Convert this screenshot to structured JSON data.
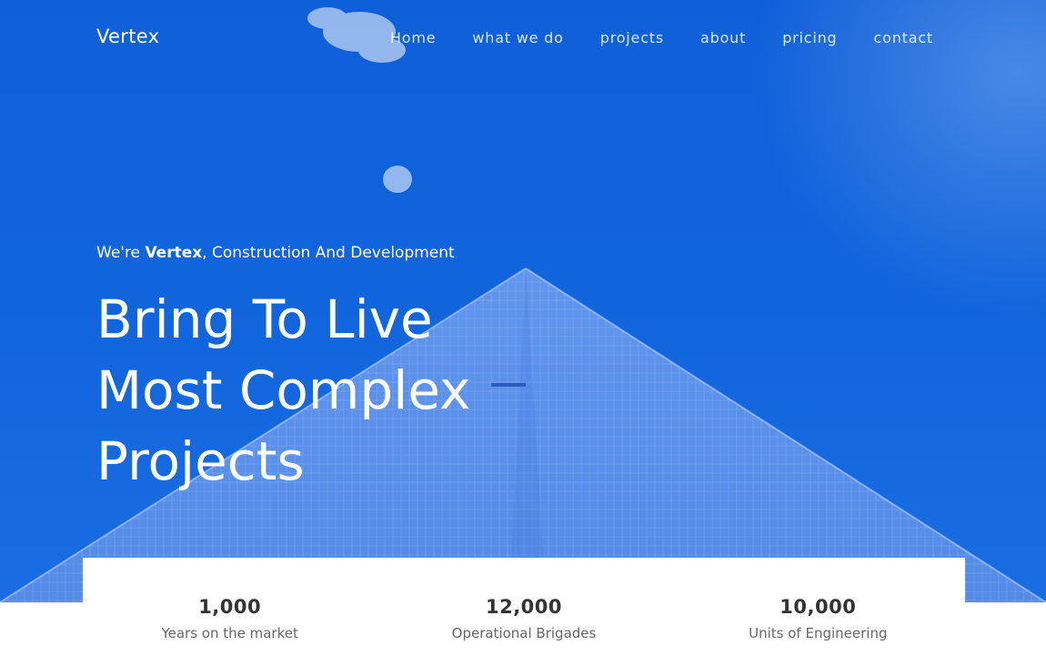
{
  "brand": "Vertex",
  "nav": {
    "items": [
      "Home",
      "what we do",
      "projects",
      "about",
      "pricing",
      "contact"
    ]
  },
  "hero": {
    "tagline_prefix": "We're ",
    "tagline_brand": "Vertex",
    "tagline_suffix": ", Construction And Development",
    "headline_lines": [
      "Bring To Live",
      "Most Complex",
      "Projects"
    ]
  },
  "stats": [
    {
      "value": "1,000",
      "label": "Years on the market"
    },
    {
      "value": "12,000",
      "label": "Operational Brigades"
    },
    {
      "value": "10,000",
      "label": "Units of Engineering"
    }
  ],
  "colors": {
    "hero_blue": "#1064dc",
    "text_dark": "#333333",
    "text_muted": "#666666"
  }
}
